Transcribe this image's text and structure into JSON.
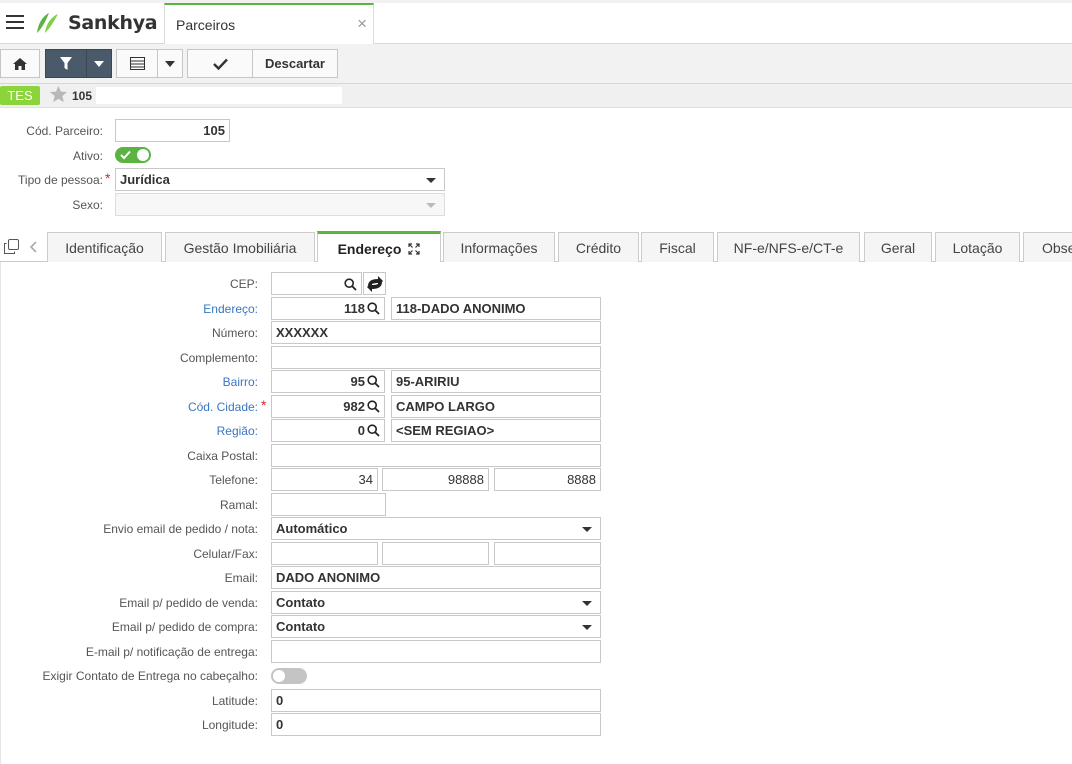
{
  "header": {
    "brand": "Sankhya",
    "tab_title": "Parceiros",
    "close_glyph": "×"
  },
  "toolbar": {
    "discard_label": "Descartar"
  },
  "record": {
    "badge": "TES",
    "id": "105"
  },
  "partner": {
    "code_label": "Cód. Parceiro:",
    "code_value": "105",
    "active_label": "Ativo:",
    "active": true,
    "person_type_label": "Tipo de pessoa:",
    "person_type_value": "Jurídica",
    "sex_label": "Sexo:",
    "sex_value": ""
  },
  "tabs": [
    {
      "label": "Identificação"
    },
    {
      "label": "Gestão Imobiliária"
    },
    {
      "label": "Endereço"
    },
    {
      "label": "Informações"
    },
    {
      "label": "Crédito"
    },
    {
      "label": "Fiscal"
    },
    {
      "label": "NF-e/NFS-e/CT-e"
    },
    {
      "label": "Geral"
    },
    {
      "label": "Lotação"
    },
    {
      "label": "Obse"
    }
  ],
  "address": {
    "cep_label": "CEP:",
    "cep_value": "",
    "endereco_label": "Endereço:",
    "endereco_code": "118",
    "endereco_name": "118-DADO ANONIMO",
    "numero_label": "Número:",
    "numero_value": "XXXXXX",
    "complemento_label": "Complemento:",
    "complemento_value": "",
    "bairro_label": "Bairro:",
    "bairro_code": "95",
    "bairro_name": "95-ARIRIU",
    "cidade_label": "Cód. Cidade:",
    "cidade_code": "982",
    "cidade_name": "CAMPO LARGO",
    "regiao_label": "Região:",
    "regiao_code": "0",
    "regiao_name": "<SEM REGIAO>",
    "caixa_label": "Caixa Postal:",
    "caixa_value": "",
    "telefone_label": "Telefone:",
    "telefone_ddd": "34",
    "telefone_part1": "98888",
    "telefone_part2": "8888",
    "ramal_label": "Ramal:",
    "ramal_value": "",
    "envio_label": "Envio email de pedido / nota:",
    "envio_value": "Automático",
    "celular_label": "Celular/Fax:",
    "celular_1": "",
    "celular_2": "",
    "celular_3": "",
    "email_label": "Email:",
    "email_value": "DADO ANONIMO",
    "email_venda_label": "Email p/ pedido de venda:",
    "email_venda_value": "Contato",
    "email_compra_label": "Email p/ pedido de compra:",
    "email_compra_value": "Contato",
    "email_entrega_label": "E-mail p/ notificação de entrega:",
    "email_entrega_value": "",
    "exigir_label": "Exigir Contato de Entrega no cabeçalho:",
    "exigir_value": false,
    "latitude_label": "Latitude:",
    "latitude_value": "0",
    "longitude_label": "Longitude:",
    "longitude_value": "0"
  },
  "colors": {
    "accent": "#5bb441",
    "link": "#3b76c0",
    "badge": "#8bd43b",
    "filter_button": "#4a5a6a"
  }
}
